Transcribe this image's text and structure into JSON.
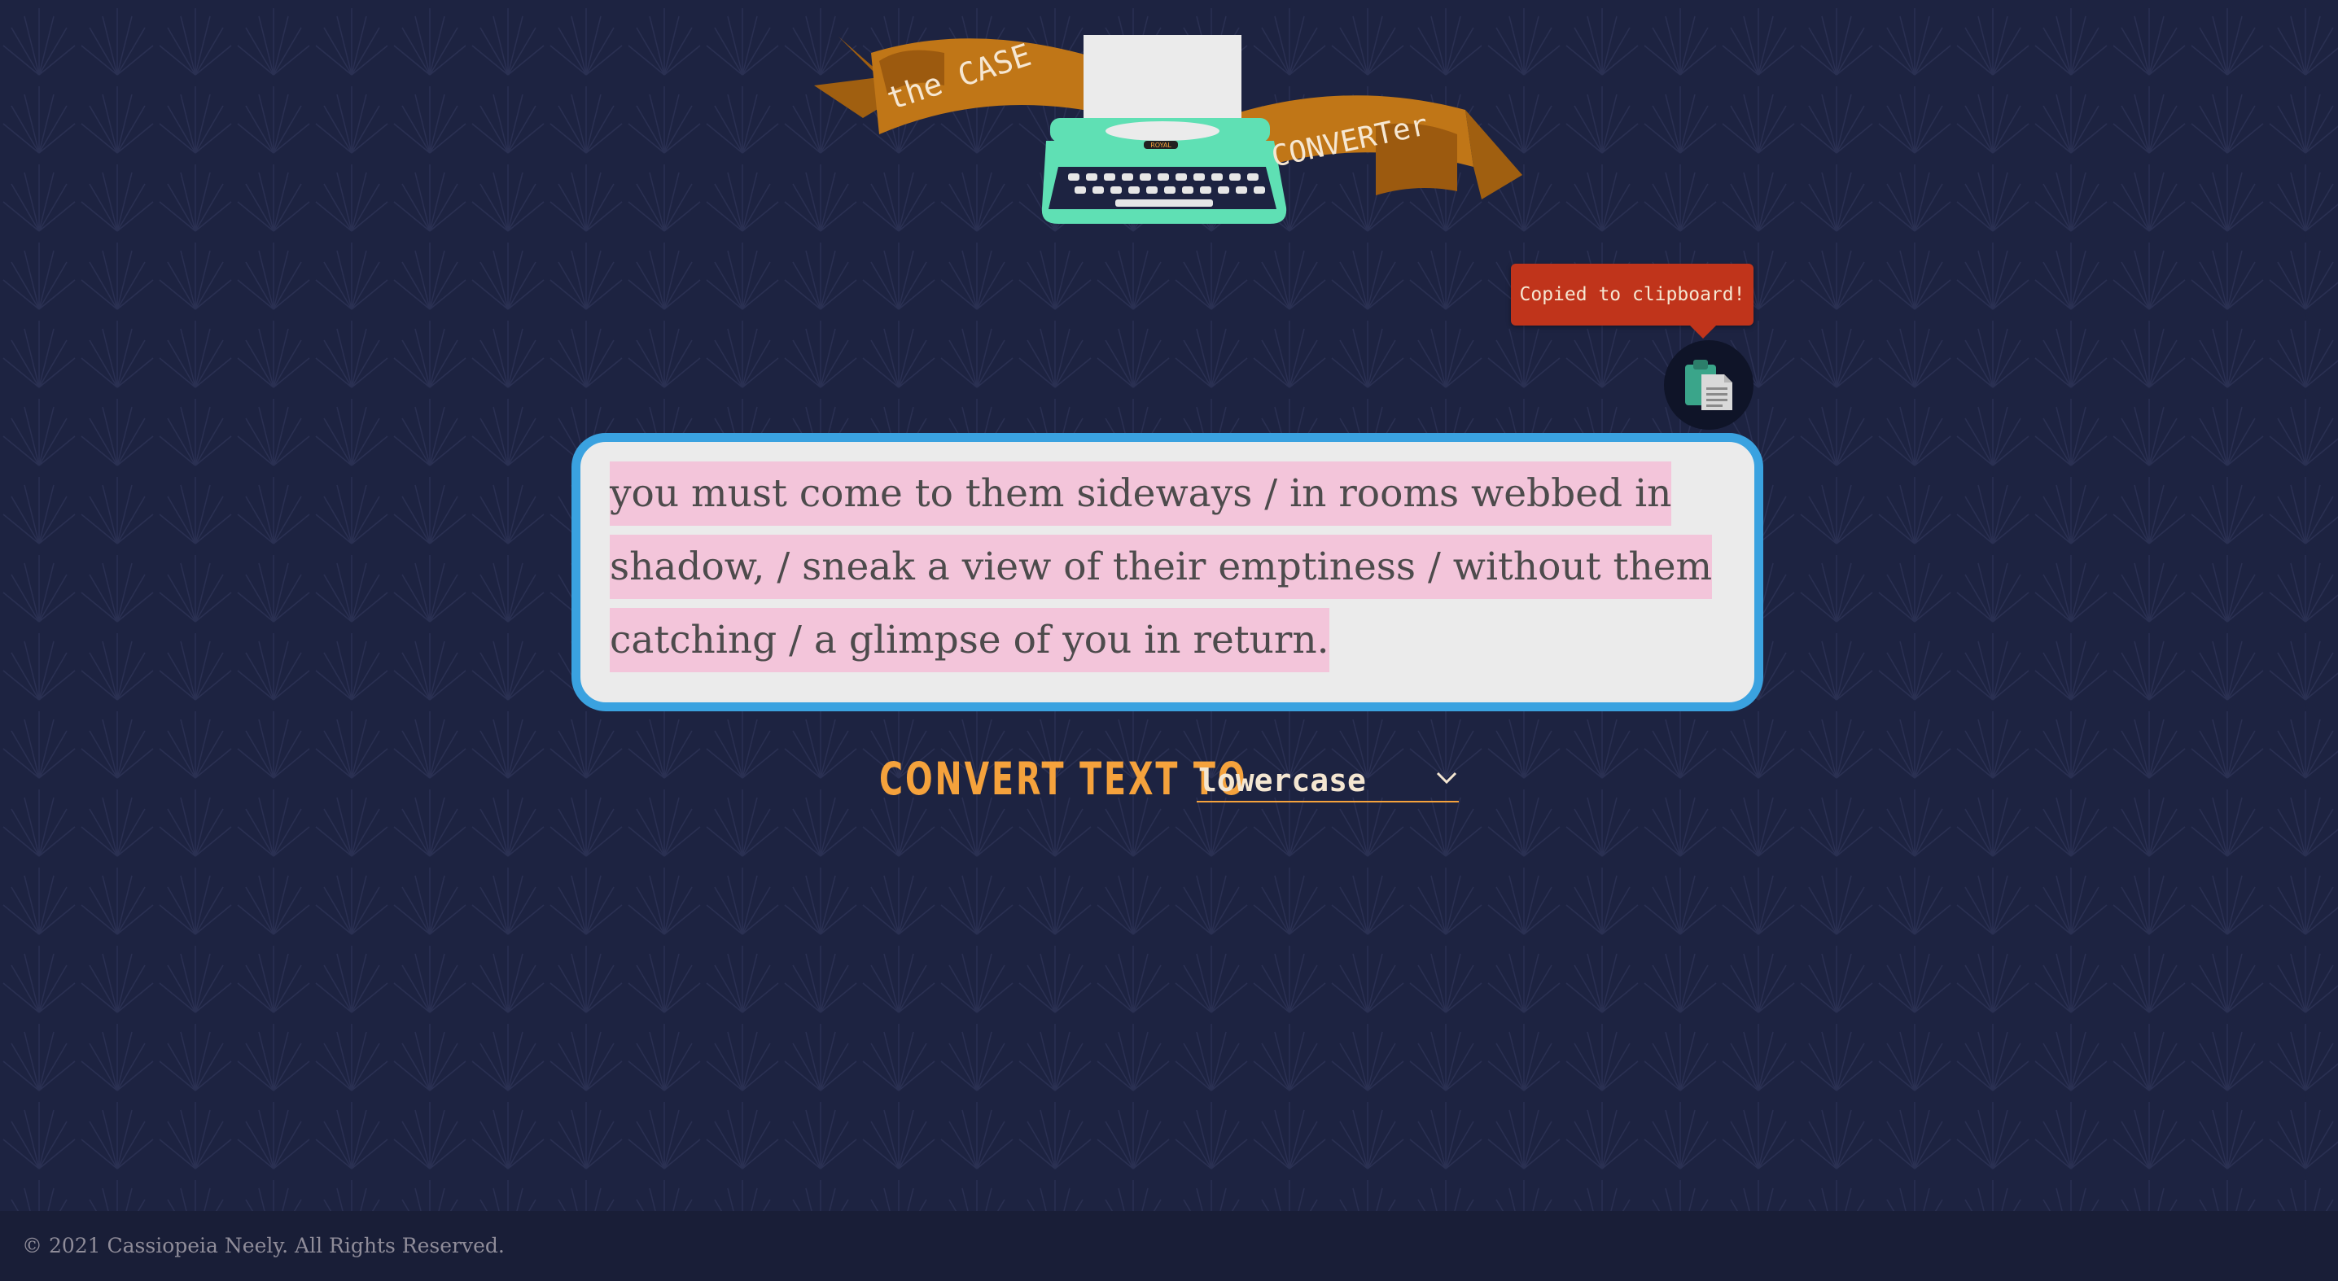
{
  "app": {
    "logo": {
      "text_left": "the CASE",
      "text_right": "CONVERTer",
      "typewriter_brand": "ROYAL"
    }
  },
  "copy": {
    "tooltip": "Copied to clipboard!",
    "icon": "clipboard-icon"
  },
  "editor": {
    "text": "you must come to them sideways / in rooms webbed in shadow, / sneak a view of their emptiness / without them catching / a glimpse of you in return."
  },
  "converter": {
    "label": "CONVERT TEXT TO",
    "selected_case": "lowercase",
    "dropdown_icon": "chevron-down-icon"
  },
  "footer": {
    "copyright": "© 2021 Cassiopeia Neely. All Rights Reserved."
  },
  "colors": {
    "background": "#1d2341",
    "accent_orange": "#f5a23c",
    "banner_orange": "#c07617",
    "card_border": "#3aa2e0",
    "selection": "#f3c5da",
    "tooltip": "#c0341b",
    "typewriter_mint": "#5fe0b4"
  }
}
